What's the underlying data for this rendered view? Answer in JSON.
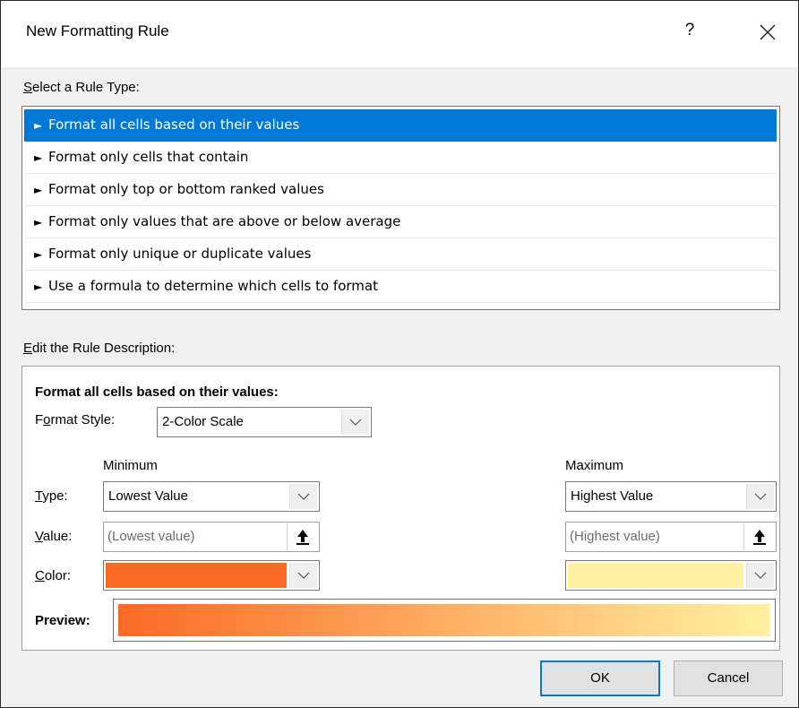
{
  "window": {
    "title": "New Formatting Rule",
    "help_glyph": "?",
    "close_icon": "close-icon"
  },
  "rule_type": {
    "label_accel": "S",
    "label_rest": "elect a Rule Type:",
    "items": [
      {
        "arrow": "►",
        "label": "Format all cells based on their values",
        "selected": true
      },
      {
        "arrow": "►",
        "label": "Format only cells that contain",
        "selected": false
      },
      {
        "arrow": "►",
        "label": "Format only top or bottom ranked values",
        "selected": false
      },
      {
        "arrow": "►",
        "label": "Format only values that are above or below average",
        "selected": false
      },
      {
        "arrow": "►",
        "label": "Format only unique or duplicate values",
        "selected": false
      },
      {
        "arrow": "►",
        "label": "Use a formula to determine which cells to format",
        "selected": false
      }
    ]
  },
  "description": {
    "label_accel": "E",
    "label_rest": "dit the Rule Description:",
    "heading": "Format all cells based on their values:",
    "format_style": {
      "label_pre": "F",
      "label_accel": "o",
      "label_rest": "rmat Style:",
      "value": "2-Color Scale"
    },
    "minimum_header": "Minimum",
    "maximum_header": "Maximum",
    "type_label": {
      "accel": "T",
      "rest": "ype:"
    },
    "value_label": {
      "accel": "V",
      "rest": "alue:"
    },
    "color_label": {
      "accel": "C",
      "rest": "olor:"
    },
    "min_type": "Lowest Value",
    "max_type": "Highest Value",
    "min_value_placeholder": "(Lowest value)",
    "max_value_placeholder": "(Highest value)",
    "min_color": "#fb6a25",
    "max_color": "#fff1a1",
    "preview_label": "Preview:"
  },
  "buttons": {
    "ok": "OK",
    "cancel": "Cancel"
  },
  "colors": {
    "selection": "#0078d7",
    "dialog_bg": "#f0f0f0"
  }
}
